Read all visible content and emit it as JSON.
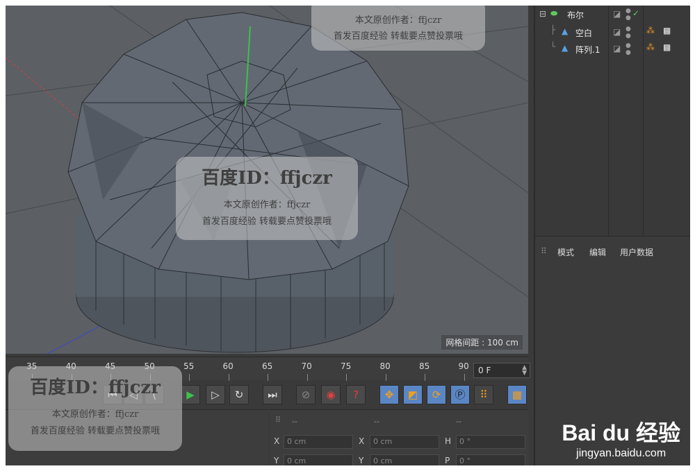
{
  "viewport": {
    "grid_spacing_label": "网格间距 : 100 cm"
  },
  "timeline": {
    "ticks": [
      "35",
      "40",
      "45",
      "50",
      "55",
      "60",
      "65",
      "70",
      "75",
      "80",
      "85",
      "90"
    ],
    "current_frame": "0 F"
  },
  "object_manager": {
    "items": [
      {
        "name": "布尔",
        "level": 0
      },
      {
        "name": "空白",
        "level": 1
      },
      {
        "name": "阵列.1",
        "level": 1
      }
    ]
  },
  "attributes": {
    "tabs": [
      "模式",
      "编辑",
      "用户数据"
    ]
  },
  "coordinates": {
    "header_dashes": [
      "--",
      "--",
      "--"
    ],
    "rows": [
      {
        "a_axis": "X",
        "a_val": "0 cm",
        "b_axis": "X",
        "b_val": "0 cm",
        "c_axis": "H",
        "c_val": "0 °"
      },
      {
        "a_axis": "Y",
        "a_val": "0 cm",
        "b_axis": "Y",
        "b_val": "0 cm",
        "c_axis": "P",
        "c_val": "0 °"
      }
    ]
  },
  "watermarks": {
    "id_text": "百度ID：ffjczr",
    "line1": "本文原创作者：ffjczr",
    "line2": "首发百度经验 转载要点赞投票哦",
    "brand": "Bai du 经验",
    "brand_url": "jingyan.baidu.com"
  },
  "colors": {
    "accent_blue": "#5b86c4",
    "mesh": "#6a7079",
    "play_green": "#3cc24a"
  }
}
